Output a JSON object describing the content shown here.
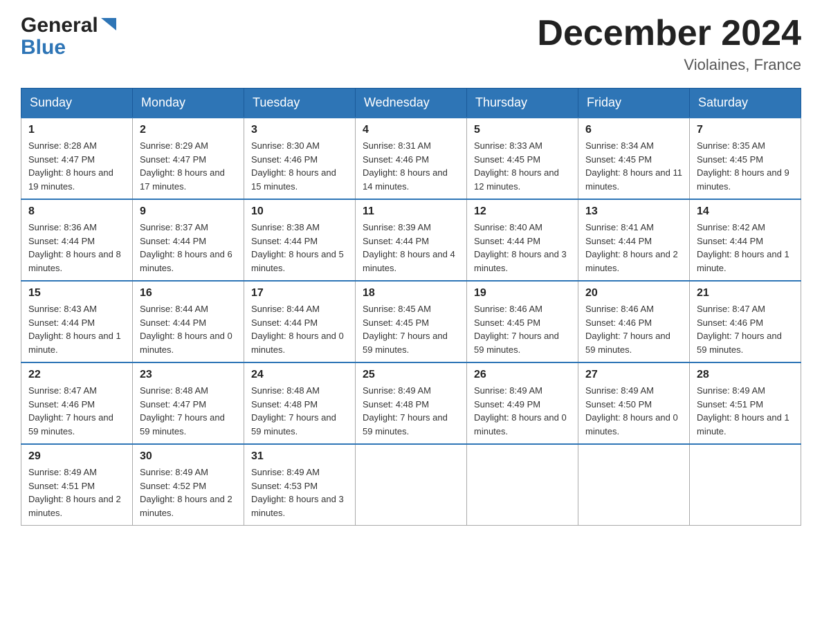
{
  "header": {
    "logo_general": "General",
    "logo_blue": "Blue",
    "month_title": "December 2024",
    "location": "Violaines, France"
  },
  "calendar": {
    "days_of_week": [
      "Sunday",
      "Monday",
      "Tuesday",
      "Wednesday",
      "Thursday",
      "Friday",
      "Saturday"
    ],
    "weeks": [
      [
        {
          "day": "1",
          "sunrise": "8:28 AM",
          "sunset": "4:47 PM",
          "daylight": "8 hours and 19 minutes."
        },
        {
          "day": "2",
          "sunrise": "8:29 AM",
          "sunset": "4:47 PM",
          "daylight": "8 hours and 17 minutes."
        },
        {
          "day": "3",
          "sunrise": "8:30 AM",
          "sunset": "4:46 PM",
          "daylight": "8 hours and 15 minutes."
        },
        {
          "day": "4",
          "sunrise": "8:31 AM",
          "sunset": "4:46 PM",
          "daylight": "8 hours and 14 minutes."
        },
        {
          "day": "5",
          "sunrise": "8:33 AM",
          "sunset": "4:45 PM",
          "daylight": "8 hours and 12 minutes."
        },
        {
          "day": "6",
          "sunrise": "8:34 AM",
          "sunset": "4:45 PM",
          "daylight": "8 hours and 11 minutes."
        },
        {
          "day": "7",
          "sunrise": "8:35 AM",
          "sunset": "4:45 PM",
          "daylight": "8 hours and 9 minutes."
        }
      ],
      [
        {
          "day": "8",
          "sunrise": "8:36 AM",
          "sunset": "4:44 PM",
          "daylight": "8 hours and 8 minutes."
        },
        {
          "day": "9",
          "sunrise": "8:37 AM",
          "sunset": "4:44 PM",
          "daylight": "8 hours and 6 minutes."
        },
        {
          "day": "10",
          "sunrise": "8:38 AM",
          "sunset": "4:44 PM",
          "daylight": "8 hours and 5 minutes."
        },
        {
          "day": "11",
          "sunrise": "8:39 AM",
          "sunset": "4:44 PM",
          "daylight": "8 hours and 4 minutes."
        },
        {
          "day": "12",
          "sunrise": "8:40 AM",
          "sunset": "4:44 PM",
          "daylight": "8 hours and 3 minutes."
        },
        {
          "day": "13",
          "sunrise": "8:41 AM",
          "sunset": "4:44 PM",
          "daylight": "8 hours and 2 minutes."
        },
        {
          "day": "14",
          "sunrise": "8:42 AM",
          "sunset": "4:44 PM",
          "daylight": "8 hours and 1 minute."
        }
      ],
      [
        {
          "day": "15",
          "sunrise": "8:43 AM",
          "sunset": "4:44 PM",
          "daylight": "8 hours and 1 minute."
        },
        {
          "day": "16",
          "sunrise": "8:44 AM",
          "sunset": "4:44 PM",
          "daylight": "8 hours and 0 minutes."
        },
        {
          "day": "17",
          "sunrise": "8:44 AM",
          "sunset": "4:44 PM",
          "daylight": "8 hours and 0 minutes."
        },
        {
          "day": "18",
          "sunrise": "8:45 AM",
          "sunset": "4:45 PM",
          "daylight": "7 hours and 59 minutes."
        },
        {
          "day": "19",
          "sunrise": "8:46 AM",
          "sunset": "4:45 PM",
          "daylight": "7 hours and 59 minutes."
        },
        {
          "day": "20",
          "sunrise": "8:46 AM",
          "sunset": "4:46 PM",
          "daylight": "7 hours and 59 minutes."
        },
        {
          "day": "21",
          "sunrise": "8:47 AM",
          "sunset": "4:46 PM",
          "daylight": "7 hours and 59 minutes."
        }
      ],
      [
        {
          "day": "22",
          "sunrise": "8:47 AM",
          "sunset": "4:46 PM",
          "daylight": "7 hours and 59 minutes."
        },
        {
          "day": "23",
          "sunrise": "8:48 AM",
          "sunset": "4:47 PM",
          "daylight": "7 hours and 59 minutes."
        },
        {
          "day": "24",
          "sunrise": "8:48 AM",
          "sunset": "4:48 PM",
          "daylight": "7 hours and 59 minutes."
        },
        {
          "day": "25",
          "sunrise": "8:49 AM",
          "sunset": "4:48 PM",
          "daylight": "7 hours and 59 minutes."
        },
        {
          "day": "26",
          "sunrise": "8:49 AM",
          "sunset": "4:49 PM",
          "daylight": "8 hours and 0 minutes."
        },
        {
          "day": "27",
          "sunrise": "8:49 AM",
          "sunset": "4:50 PM",
          "daylight": "8 hours and 0 minutes."
        },
        {
          "day": "28",
          "sunrise": "8:49 AM",
          "sunset": "4:51 PM",
          "daylight": "8 hours and 1 minute."
        }
      ],
      [
        {
          "day": "29",
          "sunrise": "8:49 AM",
          "sunset": "4:51 PM",
          "daylight": "8 hours and 2 minutes."
        },
        {
          "day": "30",
          "sunrise": "8:49 AM",
          "sunset": "4:52 PM",
          "daylight": "8 hours and 2 minutes."
        },
        {
          "day": "31",
          "sunrise": "8:49 AM",
          "sunset": "4:53 PM",
          "daylight": "8 hours and 3 minutes."
        },
        null,
        null,
        null,
        null
      ]
    ]
  }
}
